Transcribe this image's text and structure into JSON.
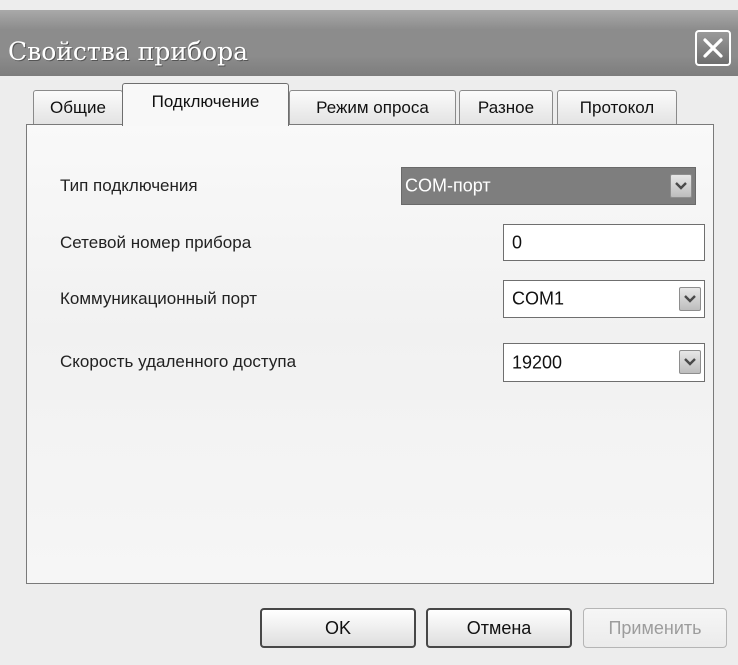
{
  "window": {
    "title": "Свойства прибора"
  },
  "tabs": [
    {
      "label": "Общие"
    },
    {
      "label": "Подключение"
    },
    {
      "label": "Режим опроса"
    },
    {
      "label": "Разное"
    },
    {
      "label": "Протокол"
    }
  ],
  "active_tab": "Подключение",
  "form": {
    "connection_type": {
      "label": "Тип подключения",
      "value": "COM-порт"
    },
    "network_number": {
      "label": "Сетевой номер прибора",
      "value": "0"
    },
    "comm_port": {
      "label": "Коммуникационный порт",
      "value": "COM1"
    },
    "baud_rate": {
      "label": "Скорость удаленного доступа",
      "value": "19200"
    }
  },
  "buttons": {
    "ok": "OK",
    "cancel": "Отмена",
    "apply": "Применить"
  },
  "icons": {
    "close": "close-icon",
    "dropdown": "chevron-down-icon"
  }
}
